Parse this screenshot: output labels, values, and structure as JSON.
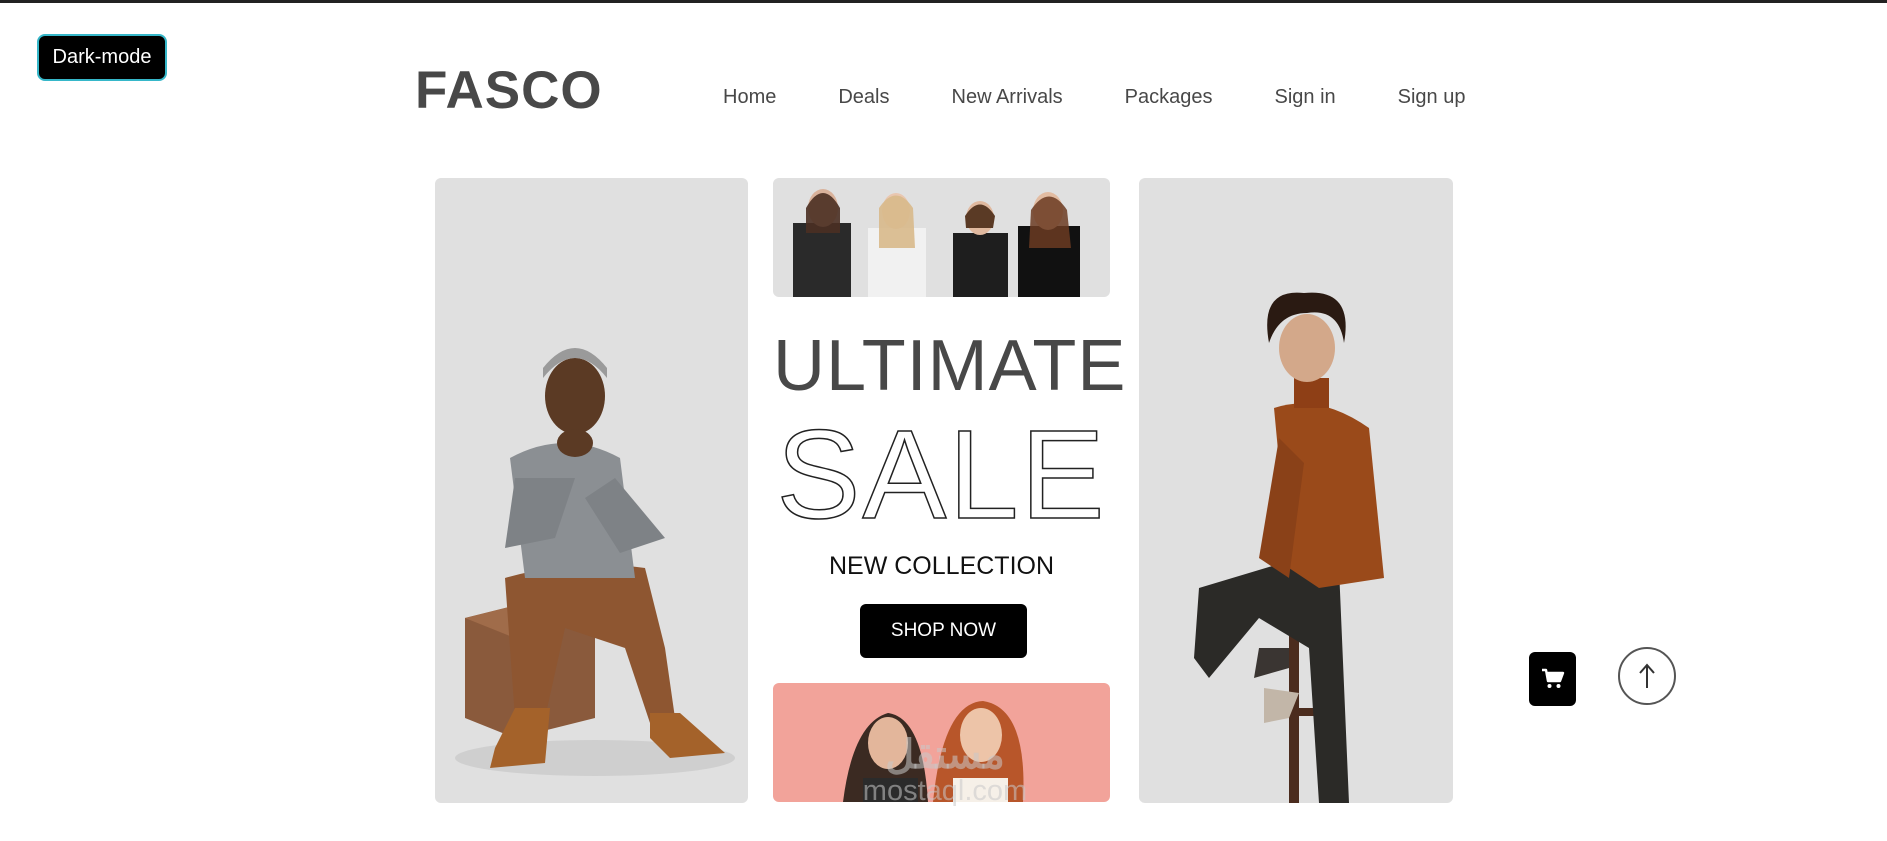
{
  "theme_toggle": {
    "label": "Dark-mode"
  },
  "brand": {
    "logo": "FASCO"
  },
  "nav": {
    "items": [
      {
        "label": "Home"
      },
      {
        "label": "Deals"
      },
      {
        "label": "New Arrivals"
      },
      {
        "label": "Packages"
      },
      {
        "label": "Sign in"
      },
      {
        "label": "Sign up"
      }
    ]
  },
  "hero": {
    "headline": "ULTIMATE",
    "headline_outline": "SALE",
    "subheadline": "NEW COLLECTION",
    "cta_label": "SHOP NOW"
  },
  "floating": {
    "cart_icon": "cart-icon",
    "scroll_top_icon": "arrow-up-icon"
  },
  "watermark": {
    "arabic": "مستقل",
    "latin": "mostaql.com"
  },
  "colors": {
    "text_dark": "#484848",
    "panel_bg": "#e0e0e0",
    "pink_panel": "#f2a39a",
    "button_bg": "#000000",
    "toggle_border": "#36b7c9"
  }
}
